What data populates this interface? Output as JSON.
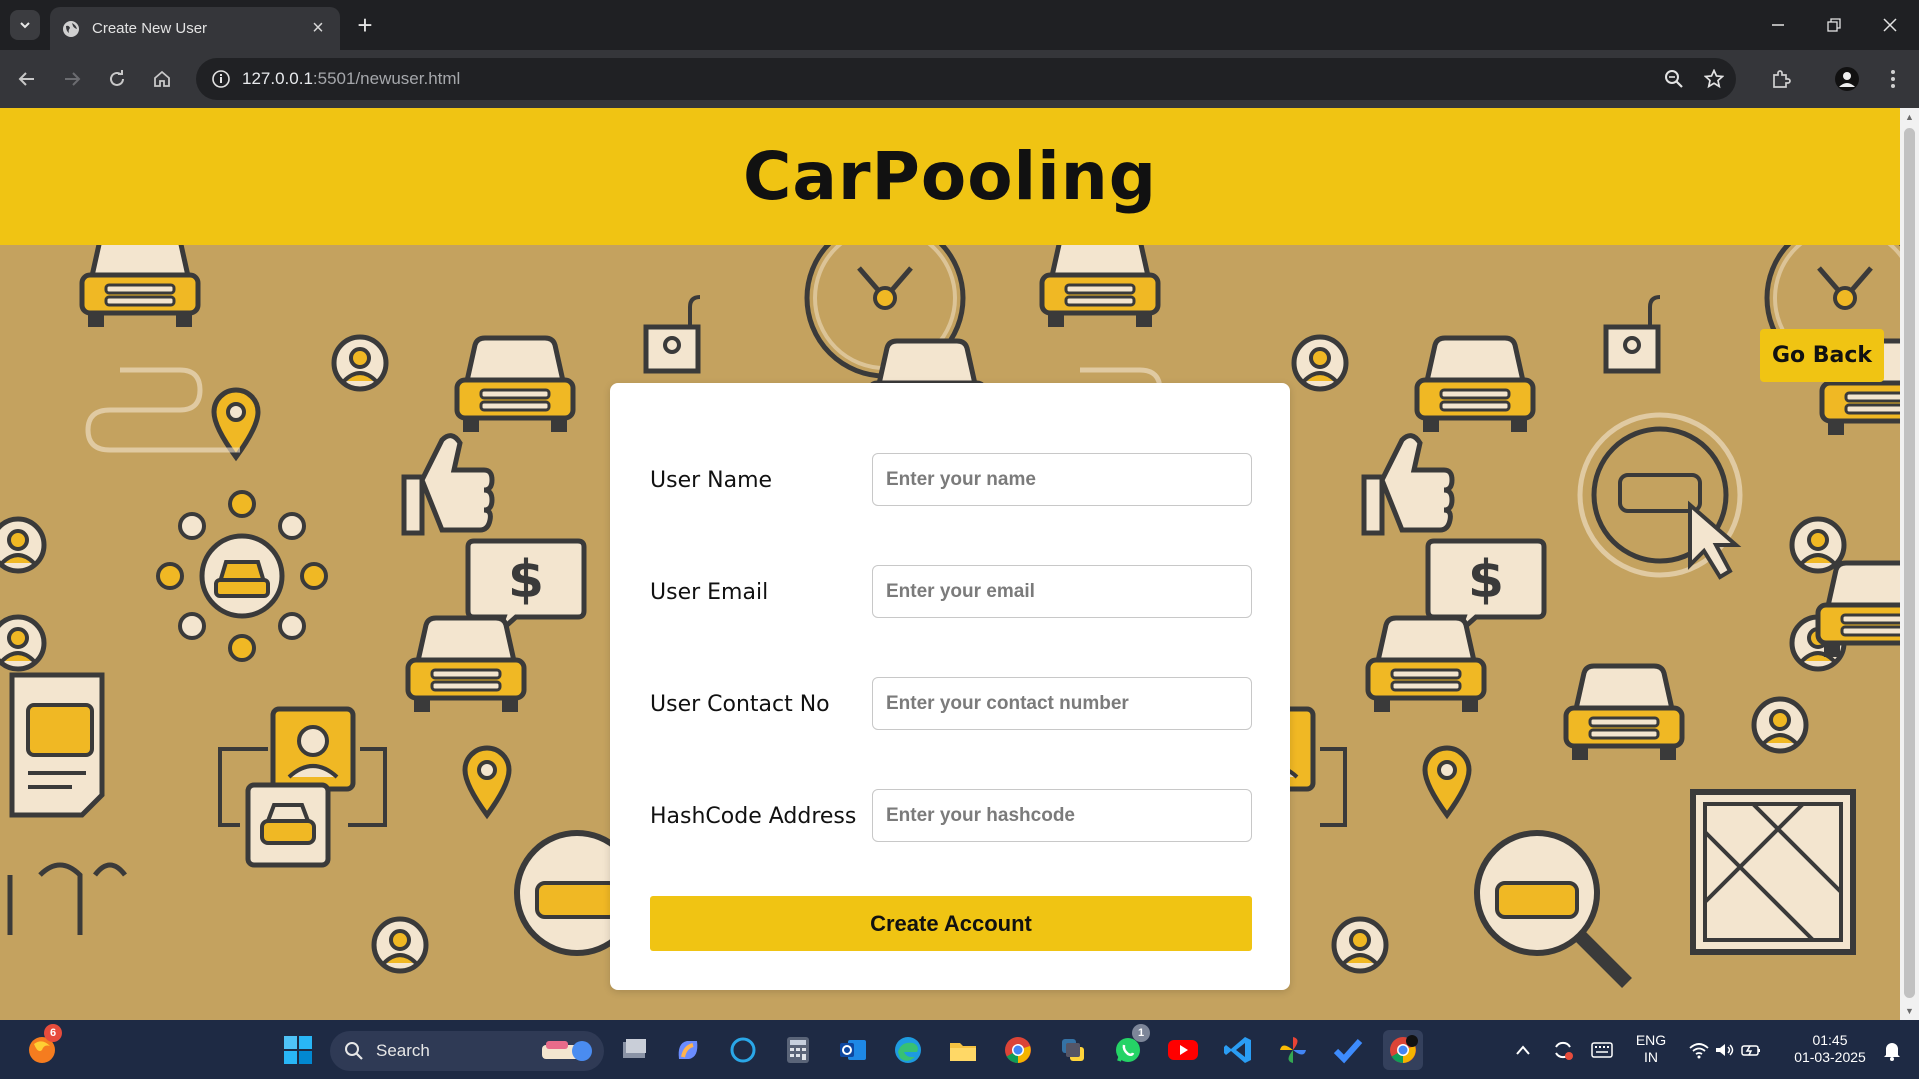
{
  "browser": {
    "tab_title": "Create New User",
    "url_host": "127.0.0.1",
    "url_rest": ":5501/newuser.html"
  },
  "page": {
    "brand": "CarPooling",
    "go_back": "Go Back",
    "form": {
      "fields": [
        {
          "label": "User Name",
          "placeholder": "Enter your name"
        },
        {
          "label": "User Email",
          "placeholder": "Enter your email"
        },
        {
          "label": "User Contact No",
          "placeholder": "Enter your contact number"
        },
        {
          "label": "HashCode Address",
          "placeholder": "Enter your hashcode"
        }
      ],
      "submit": "Create Account"
    }
  },
  "taskbar": {
    "search_label": "Search",
    "firefox_badge": "6",
    "whatsapp_badge": "1",
    "lang_line1": "ENG",
    "lang_line2": "IN",
    "time": "01:45",
    "date": "01-03-2025"
  },
  "colors": {
    "accent_yellow": "#f0c413",
    "background_tan": "#c4a25f",
    "chrome_dark": "#1f2023"
  }
}
